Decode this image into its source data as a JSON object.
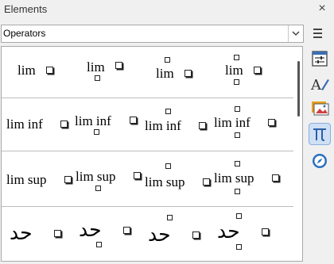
{
  "panel": {
    "title": "Elements",
    "close_label": "×"
  },
  "category": {
    "selected": "Operators"
  },
  "elements": {
    "rows": [
      [
        "lim",
        "lim",
        "lim",
        "lim"
      ],
      [
        "lim inf",
        "lim inf",
        "lim inf",
        "lim inf"
      ],
      [
        "lim sup",
        "lim sup",
        "lim sup",
        "lim sup"
      ],
      [
        "حد",
        "حد",
        "حد",
        "حد"
      ]
    ]
  },
  "sidebar": {
    "items": [
      {
        "name": "properties"
      },
      {
        "name": "styles"
      },
      {
        "name": "gallery"
      },
      {
        "name": "elements",
        "active": true
      },
      {
        "name": "navigator"
      }
    ]
  },
  "colors": {
    "accent": "#cfe0f4",
    "grid_line": "#bdbdbd"
  }
}
